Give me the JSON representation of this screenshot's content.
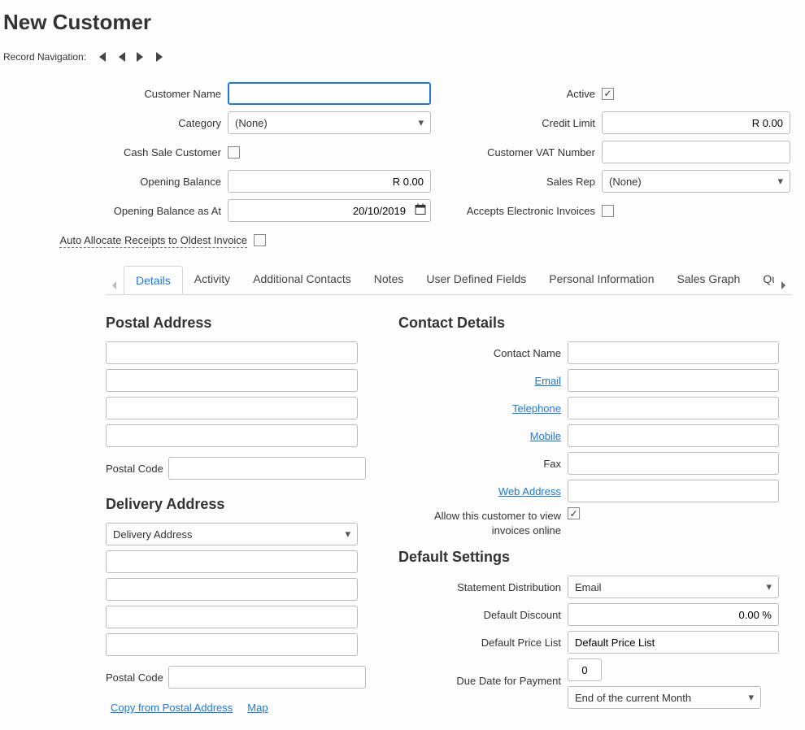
{
  "page_title": "New Customer",
  "record_nav_label": "Record Navigation:",
  "form": {
    "customer_name_label": "Customer Name",
    "customer_name_value": "",
    "category_label": "Category",
    "category_value": "(None)",
    "cash_sale_label": "Cash Sale Customer",
    "cash_sale_checked": false,
    "opening_balance_label": "Opening Balance",
    "opening_balance_value": "R 0.00",
    "opening_balance_asat_label": "Opening Balance as At",
    "opening_balance_asat_value": "20/10/2019",
    "auto_allocate_label": "Auto Allocate Receipts to Oldest Invoice",
    "auto_allocate_checked": false,
    "active_label": "Active",
    "active_checked": true,
    "credit_limit_label": "Credit Limit",
    "credit_limit_value": "R 0.00",
    "vat_label": "Customer VAT Number",
    "vat_value": "",
    "sales_rep_label": "Sales Rep",
    "sales_rep_value": "(None)",
    "accepts_einv_label": "Accepts Electronic Invoices",
    "accepts_einv_checked": false
  },
  "tabs": {
    "details": "Details",
    "activity": "Activity",
    "additional_contacts": "Additional Contacts",
    "notes": "Notes",
    "user_defined_fields": "User Defined Fields",
    "personal_information": "Personal Information",
    "sales_graph": "Sales Graph",
    "quotes": "Quotes"
  },
  "postal": {
    "heading": "Postal Address",
    "line1": "",
    "line2": "",
    "line3": "",
    "line4": "",
    "postal_code_label": "Postal Code",
    "postal_code_value": ""
  },
  "delivery": {
    "heading": "Delivery Address",
    "select_value": "Delivery Address",
    "line1": "",
    "line2": "",
    "line3": "",
    "line4": "",
    "postal_code_label": "Postal Code",
    "postal_code_value": "",
    "copy_link": "Copy from Postal Address",
    "map_link": "Map"
  },
  "contact": {
    "heading": "Contact Details",
    "contact_name_label": "Contact Name",
    "contact_name_value": "",
    "email_label": "Email",
    "email_value": "",
    "telephone_label": "Telephone",
    "telephone_value": "",
    "mobile_label": "Mobile",
    "mobile_value": "",
    "fax_label": "Fax",
    "fax_value": "",
    "web_label": "Web Address",
    "web_value": "",
    "allow_view_label": "Allow this customer to view invoices online",
    "allow_view_checked": true
  },
  "settings": {
    "heading": "Default Settings",
    "statement_dist_label": "Statement Distribution",
    "statement_dist_value": "Email",
    "default_discount_label": "Default Discount",
    "default_discount_value": "0.00 %",
    "default_price_list_label": "Default Price List",
    "default_price_list_value": "Default Price List",
    "due_date_label": "Due Date for Payment",
    "due_date_num": "0",
    "due_date_basis": "End of the current Month"
  }
}
